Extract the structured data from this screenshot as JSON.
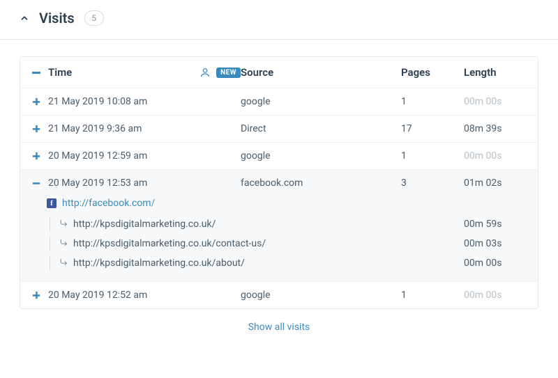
{
  "section": {
    "title": "Visits",
    "count": "5"
  },
  "headers": {
    "time": "Time",
    "source": "Source",
    "pages": "Pages",
    "length": "Length",
    "new_badge": "NEW"
  },
  "rows": [
    {
      "time": "21 May 2019 10:08 am",
      "source": "google",
      "pages": "1",
      "length": "00m 00s",
      "zero": true,
      "expanded": false
    },
    {
      "time": "21 May 2019 9:36 am",
      "source": "Direct",
      "pages": "17",
      "length": "08m 39s",
      "zero": false,
      "expanded": false
    },
    {
      "time": "20 May 2019 12:59 am",
      "source": "google",
      "pages": "1",
      "length": "00m 00s",
      "zero": true,
      "expanded": false
    },
    {
      "time": "20 May 2019 12:53 am",
      "source": "facebook.com",
      "pages": "3",
      "length": "01m 02s",
      "zero": false,
      "expanded": true,
      "referrer": "http://facebook.com/",
      "pages_detail": [
        {
          "url": "http://kpsdigitalmarketing.co.uk/",
          "length": "00m 59s"
        },
        {
          "url": "http://kpsdigitalmarketing.co.uk/contact-us/",
          "length": "00m 03s"
        },
        {
          "url": "http://kpsdigitalmarketing.co.uk/about/",
          "length": "00m 00s"
        }
      ]
    },
    {
      "time": "20 May 2019 12:52 am",
      "source": "google",
      "pages": "1",
      "length": "00m 00s",
      "zero": true,
      "expanded": false
    }
  ],
  "footer": {
    "show_all": "Show all visits"
  }
}
